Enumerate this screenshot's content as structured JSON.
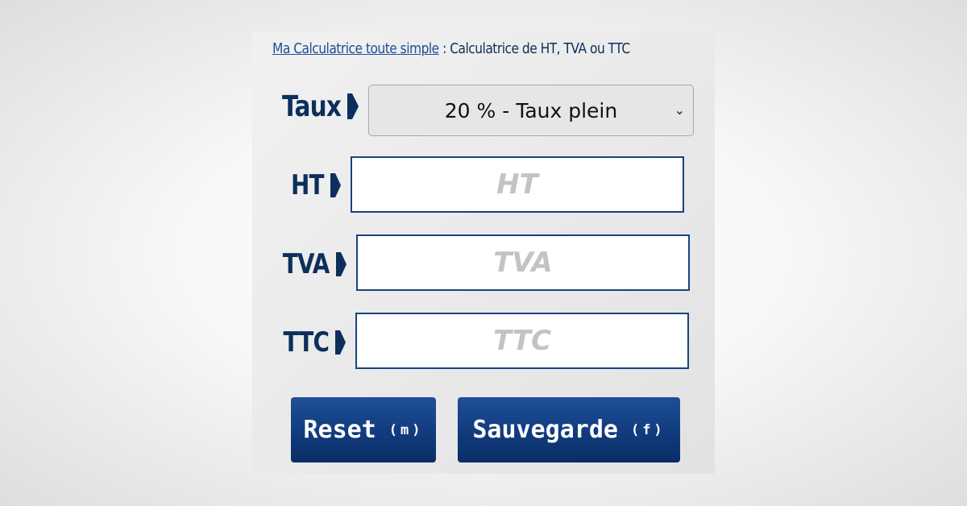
{
  "header": {
    "link_text": "Ma Calculatrice toute simple",
    "separator": " : ",
    "title": "Calculatrice de HT, TVA ou TTC"
  },
  "taux": {
    "label": "Taux",
    "selected": "20 % - Taux plein",
    "chevron": "⌄"
  },
  "fields": {
    "ht": {
      "label": "HT",
      "placeholder": "HT",
      "value": ""
    },
    "tva": {
      "label": "TVA",
      "placeholder": "TVA",
      "value": ""
    },
    "ttc": {
      "label": "TTC",
      "placeholder": "TTC",
      "value": ""
    }
  },
  "buttons": {
    "reset": {
      "label": "Reset",
      "key": "(m)"
    },
    "save": {
      "label": "Sauvegarde",
      "key": "(f)"
    }
  },
  "colors": {
    "accent": "#0d2f5c",
    "button": "#123d80",
    "field_border": "#14457e"
  },
  "icons": {
    "arrow": "arrow-right-icon",
    "select": "chevron-down-icon"
  }
}
